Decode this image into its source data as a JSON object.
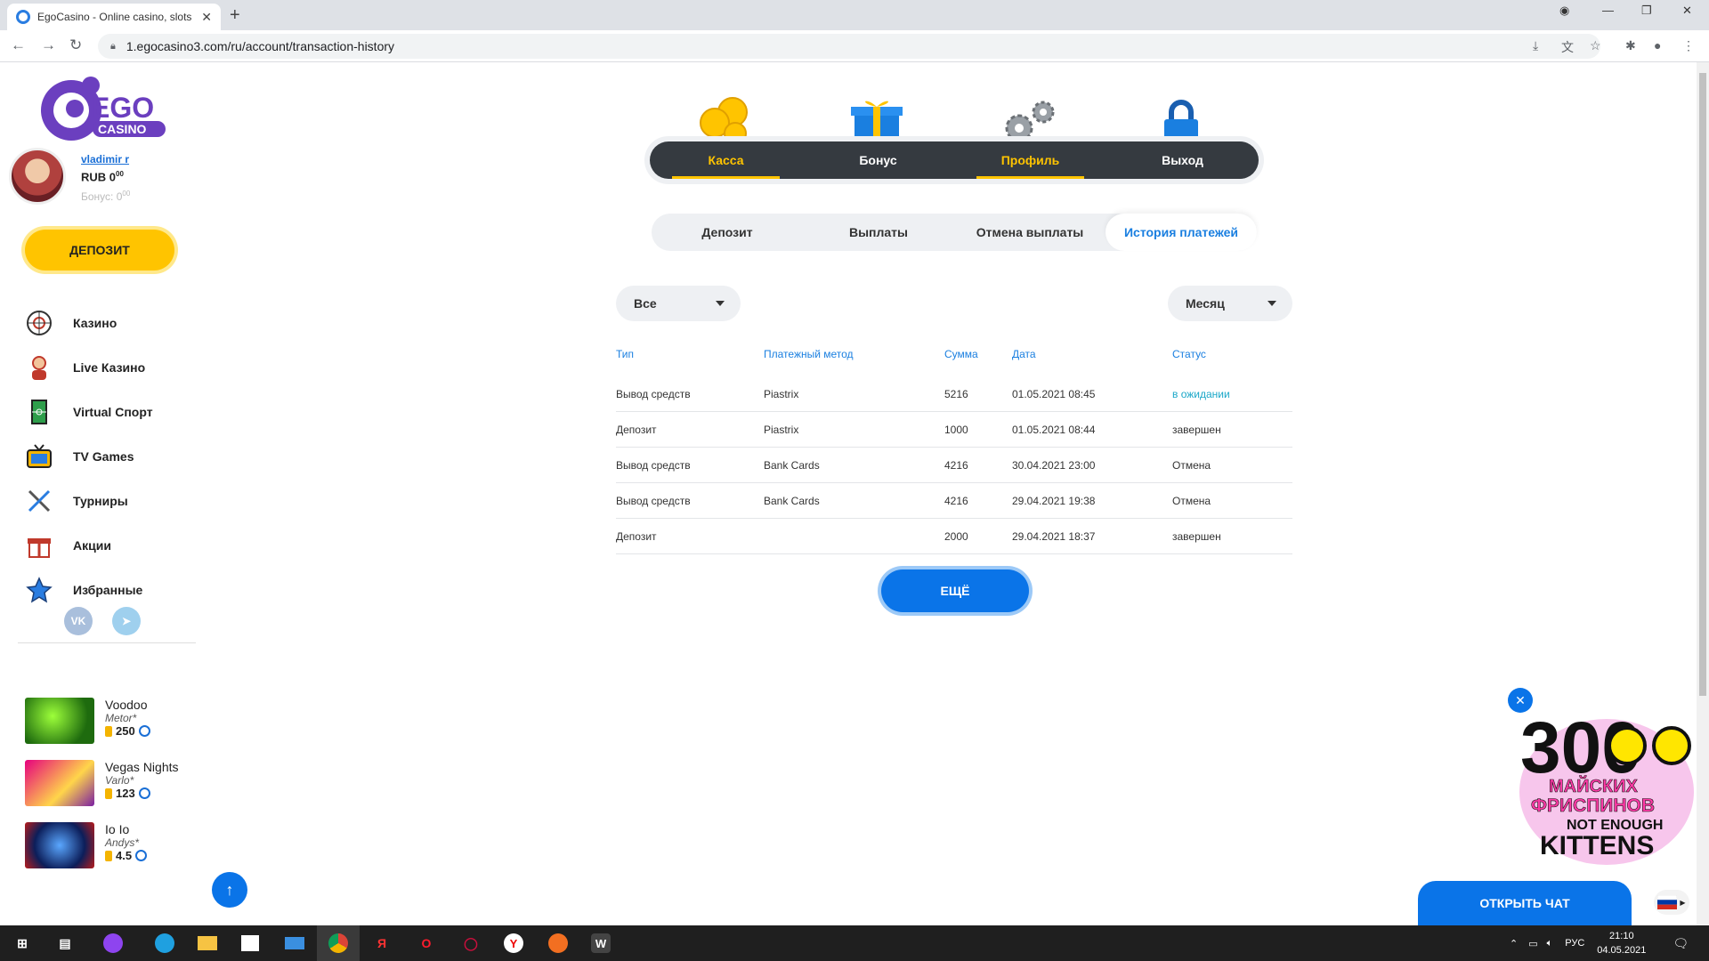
{
  "browser": {
    "tab_title": "EgoCasino - Online casino, slots",
    "url": "1.egocasino3.com/ru/account/transaction-history"
  },
  "user": {
    "name": "vladimir r",
    "balance": "RUB 0",
    "balance_cents": "00",
    "bonus": "Бонус: 0",
    "bonus_cents": "00"
  },
  "sidebar": {
    "deposit_label": "ДЕПОЗИТ",
    "menu": [
      {
        "label": "Казино",
        "icon": "roulette-icon"
      },
      {
        "label": "Live Казино",
        "icon": "dealer-icon"
      },
      {
        "label": "Virtual Спорт",
        "icon": "field-icon"
      },
      {
        "label": "TV Games",
        "icon": "tv-icon"
      },
      {
        "label": "Турниры",
        "icon": "swords-icon"
      },
      {
        "label": "Акции",
        "icon": "gift-icon"
      },
      {
        "label": "Избранные",
        "icon": "star-icon"
      }
    ],
    "socials": [
      {
        "label": "VK",
        "icon": "vk-icon"
      },
      {
        "label": "➤",
        "icon": "telegram-icon"
      }
    ],
    "recent_games": [
      {
        "name": "Voodoo",
        "provider": "Metor*",
        "rating": "250"
      },
      {
        "name": "Vegas Nights",
        "provider": "Varlo*",
        "rating": "123"
      },
      {
        "name": "Io Io",
        "provider": "Andys*",
        "rating": "4.5"
      }
    ]
  },
  "topnav": {
    "items": [
      {
        "label": "Касса",
        "active": true
      },
      {
        "label": "Бонус",
        "active": false
      },
      {
        "label": "Профиль",
        "active": true
      },
      {
        "label": "Выход",
        "active": false
      }
    ]
  },
  "subtabs": [
    {
      "label": "Депозит"
    },
    {
      "label": "Выплаты"
    },
    {
      "label": "Отмена выплаты"
    },
    {
      "label": "История платежей",
      "active": true
    }
  ],
  "filters": {
    "type_value": "Все",
    "period_value": "Месяц"
  },
  "table": {
    "headers": [
      "Тип",
      "Платежный метод",
      "Сумма",
      "Дата",
      "Статус"
    ],
    "rows": [
      [
        "Вывод средств",
        "Piastrix",
        "5216",
        "01.05.2021 08:45",
        "в ожидании"
      ],
      [
        "Депозит",
        "Piastrix",
        "1000",
        "01.05.2021 08:44",
        "завершен"
      ],
      [
        "Вывод средств",
        "Bank Cards",
        "4216",
        "30.04.2021 23:00",
        "Отмена"
      ],
      [
        "Вывод средств",
        "Bank Cards",
        "4216",
        "29.04.2021 19:38",
        "Отмена"
      ],
      [
        "Депозит",
        "",
        "2000",
        "29.04.2021 18:37",
        "завершен"
      ]
    ]
  },
  "more_label": "ЕЩЁ",
  "promo": {
    "big": "300",
    "line1": "МАЙСКИХ",
    "line2": "ФРИСПИНОВ",
    "line3": "NOT ENOUGH",
    "line4": "KITTENS"
  },
  "chat_label": "ОТКРЫТЬ ЧАТ",
  "taskbar": {
    "lang": "РУС",
    "time": "21:10",
    "date": "04.05.2021"
  },
  "colors": {
    "accent": "#0a74e8",
    "gold": "#ffc400",
    "nav_dark": "#353a40",
    "header_blue": "#1a7fe0",
    "pending": "#1aa7c8"
  }
}
